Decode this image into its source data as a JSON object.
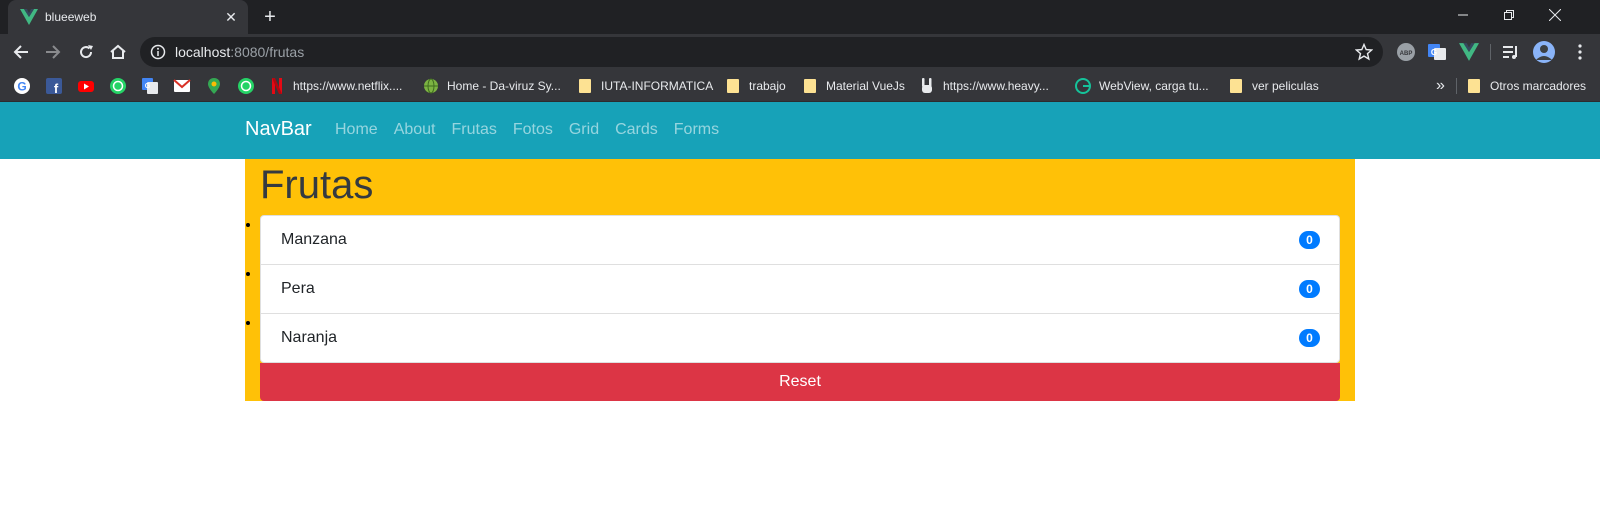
{
  "browser": {
    "tab": {
      "title": "blueeweb"
    },
    "address": {
      "host": "localhost",
      "rest": ":8080/frutas"
    },
    "bookmarks": [
      {
        "label": "https://www.netflix...."
      },
      {
        "label": "Home - Da-viruz Sy..."
      },
      {
        "label": "IUTA-INFORMATICA"
      },
      {
        "label": "trabajo"
      },
      {
        "label": "Material VueJs"
      },
      {
        "label": "https://www.heavy..."
      },
      {
        "label": "WebView, carga tu..."
      },
      {
        "label": "ver peliculas"
      }
    ],
    "overflow_label": "»",
    "other_bookmarks": "Otros marcadores"
  },
  "navbar": {
    "brand": "NavBar",
    "links": [
      "Home",
      "About",
      "Frutas",
      "Fotos",
      "Grid",
      "Cards",
      "Forms"
    ]
  },
  "main": {
    "title": "Frutas",
    "fruits": [
      {
        "name": "Manzana",
        "count": "0"
      },
      {
        "name": "Pera",
        "count": "0"
      },
      {
        "name": "Naranja",
        "count": "0"
      }
    ],
    "reset_label": "Reset"
  },
  "colors": {
    "navbar_bg": "#17a2b8",
    "container_bg": "#ffc107",
    "badge_bg": "#007bff",
    "reset_bg": "#dc3545"
  },
  "icons": {
    "tab_favicon": "vue-logo-icon",
    "omnibox_left": "info-icon",
    "omnibox_right": "star-icon"
  }
}
